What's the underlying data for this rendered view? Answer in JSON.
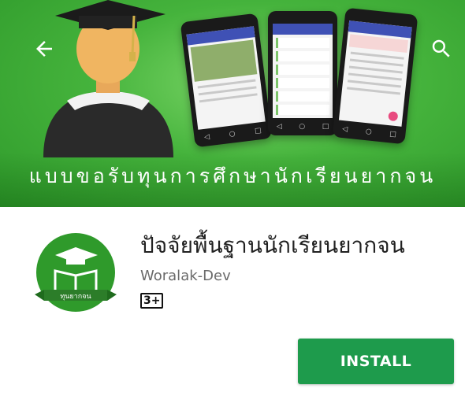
{
  "banner": {
    "title": "แบบขอรับทุนการศึกษานักเรียนยากจน",
    "back_icon": "arrow-back-icon",
    "search_icon": "search-icon",
    "background_color": "#45b33c"
  },
  "app": {
    "name": "ปัจจัยพื้นฐานนักเรียนยากจน",
    "developer": "Woralak-Dev",
    "content_rating": "3+",
    "icon_ribbon_text": "ทุนยากจน",
    "install_label": "INSTALL",
    "install_color": "#1e9b4c"
  }
}
